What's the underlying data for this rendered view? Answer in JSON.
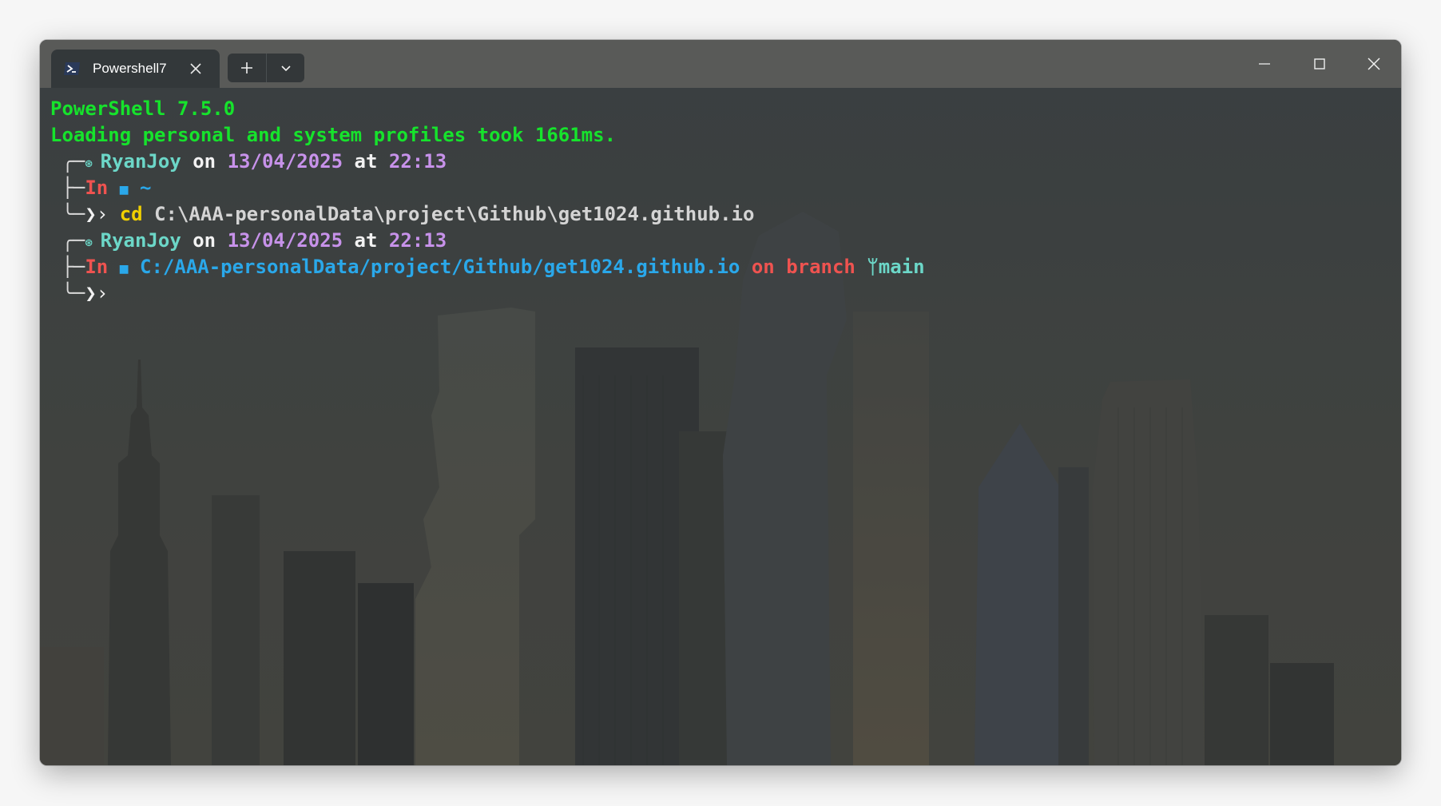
{
  "window": {
    "tab_title": "Powershell7",
    "tab_icon": "powershell-icon",
    "close_tab_icon": "close-icon",
    "new_tab_icon": "plus-icon",
    "dropdown_icon": "chevron-down-icon",
    "minimize_icon": "minimize-icon",
    "maximize_icon": "maximize-icon",
    "close_icon": "close-icon"
  },
  "terminal": {
    "banner_version": "PowerShell 7.5.0",
    "banner_profiles": "Loading personal and system profiles took 1661ms.",
    "prompt1": {
      "user": "RyanJoy",
      "on": "on",
      "date": "13/04/2025",
      "at": "at",
      "time": "22:13",
      "in": "In",
      "path": "~",
      "command_name": "cd",
      "command_args": "C:\\AAA-personalData\\project\\Github\\get1024.github.io"
    },
    "prompt2": {
      "user": "RyanJoy",
      "on": "on",
      "date": "13/04/2025",
      "at": "at",
      "time": "22:13",
      "in": "In",
      "path": "C:/AAA-personalData/project/Github/get1024.github.io",
      "branch_on": "on",
      "branch_label": "branch",
      "branch_name": "main"
    },
    "colors": {
      "banner": "#16e32c",
      "user": "#6cd7c8",
      "date": "#c792ea",
      "in": "#ef5350",
      "path": "#2aa8ea",
      "command": "#f0d000"
    }
  }
}
